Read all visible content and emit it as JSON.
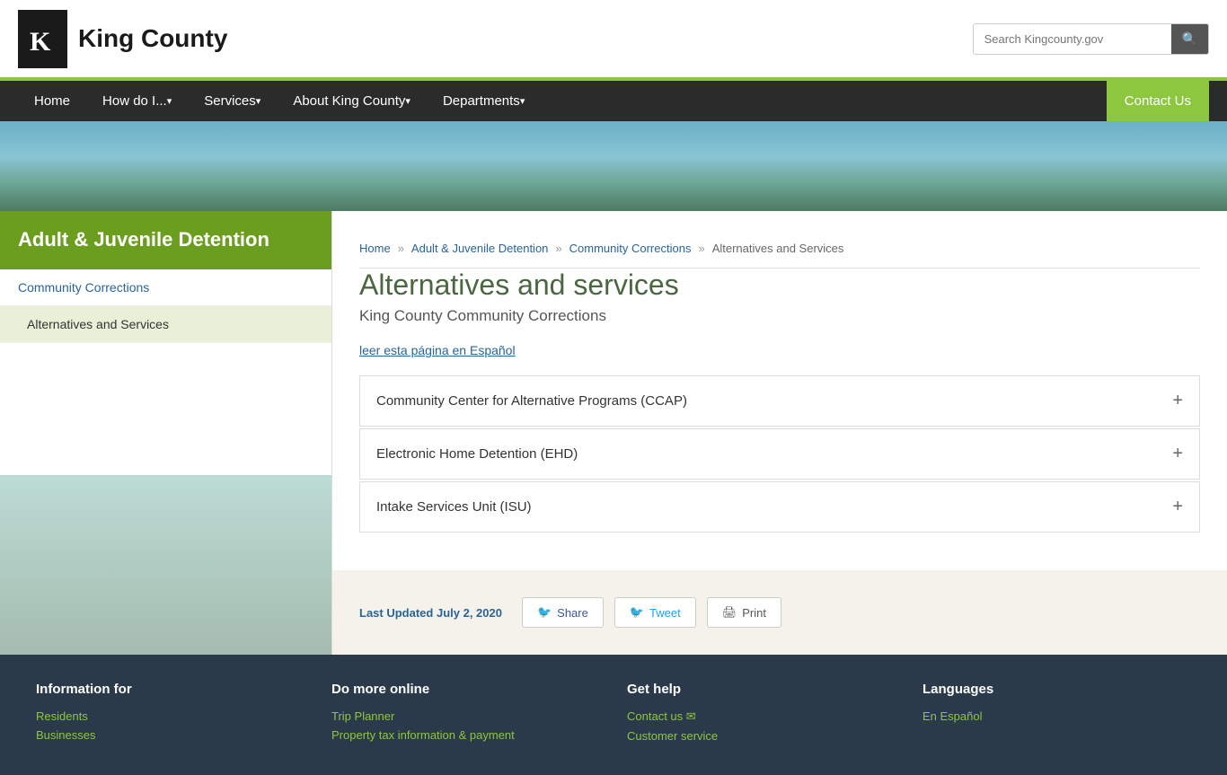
{
  "header": {
    "logo_text": "King County",
    "logo_icon": "👤",
    "search_placeholder": "Search Kingcounty.gov",
    "search_icon": "🔍"
  },
  "nav": {
    "items": [
      {
        "label": "Home",
        "dropdown": false
      },
      {
        "label": "How do I...",
        "dropdown": true
      },
      {
        "label": "Services",
        "dropdown": true
      },
      {
        "label": "About King County",
        "dropdown": true
      },
      {
        "label": "Departments",
        "dropdown": true
      }
    ],
    "cta_label": "Contact Us"
  },
  "breadcrumb": {
    "items": [
      {
        "label": "Home",
        "href": "#"
      },
      {
        "label": "Adult & Juvenile Detention",
        "href": "#"
      },
      {
        "label": "Community Corrections",
        "href": "#"
      },
      {
        "label": "Alternatives and Services",
        "href": null
      }
    ]
  },
  "sidebar": {
    "title": "Adult & Juvenile Detention",
    "nav": [
      {
        "label": "Community Corrections",
        "active": false
      },
      {
        "label": "Alternatives and Services",
        "active": true
      }
    ]
  },
  "content": {
    "page_title": "Alternatives and services",
    "page_subtitle": "King County Community Corrections",
    "spanish_link": "leer esta página en Español",
    "accordion_items": [
      {
        "title": "Community Center for Alternative Programs (CCAP)"
      },
      {
        "title": "Electronic Home Detention (EHD)"
      },
      {
        "title": "Intake Services Unit (ISU)"
      }
    ]
  },
  "footer_actions": {
    "last_updated_label": "Last Updated",
    "last_updated_date": "July 2, 2020",
    "buttons": [
      {
        "label": "Share",
        "icon": "fb"
      },
      {
        "label": "Tweet",
        "icon": "tw"
      },
      {
        "label": "Print",
        "icon": "print"
      }
    ]
  },
  "footer": {
    "columns": [
      {
        "heading": "Information for",
        "links": [
          "Residents",
          "Businesses"
        ]
      },
      {
        "heading": "Do more online",
        "links": [
          "Trip Planner",
          "Property tax information & payment"
        ]
      },
      {
        "heading": "Get help",
        "links": [
          "Contact us ✉",
          "Customer service"
        ]
      },
      {
        "heading": "Languages",
        "links": [
          "En Español"
        ]
      }
    ]
  }
}
